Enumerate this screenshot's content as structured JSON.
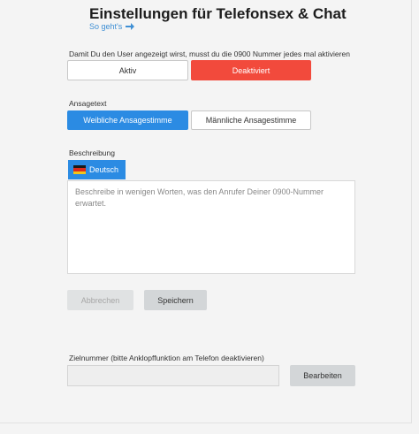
{
  "header": {
    "title": "Einstellungen für Telefonsex & Chat",
    "howto_label": "So geht's"
  },
  "activation": {
    "instruction": "Damit Du den User angezeigt wirst, musst du die 0900 Nummer jedes mal aktivieren",
    "active_label": "Aktiv",
    "inactive_label": "Deaktiviert",
    "selected": "Deaktiviert"
  },
  "announcement": {
    "label": "Ansagetext",
    "female_label": "Weibliche Ansagestimme",
    "male_label": "Männliche Ansagestimme",
    "selected": "Weibliche Ansagestimme"
  },
  "description": {
    "label": "Beschreibung",
    "language_tab": "Deutsch",
    "placeholder": "Beschreibe in wenigen Worten, was den Anrufer Deiner 0900-Nummer erwartet.",
    "value": ""
  },
  "actions": {
    "cancel_label": "Abbrechen",
    "save_label": "Speichern"
  },
  "target_number": {
    "label": "Zielnummer (bitte Anklopffunktion am Telefon deaktivieren)",
    "value": "",
    "edit_label": "Bearbeiten"
  },
  "colors": {
    "accent_blue": "#2b8be3",
    "active_red": "#f24a3c"
  },
  "icons": {
    "howto": "arrow-right-icon",
    "language": "german-flag-icon"
  }
}
